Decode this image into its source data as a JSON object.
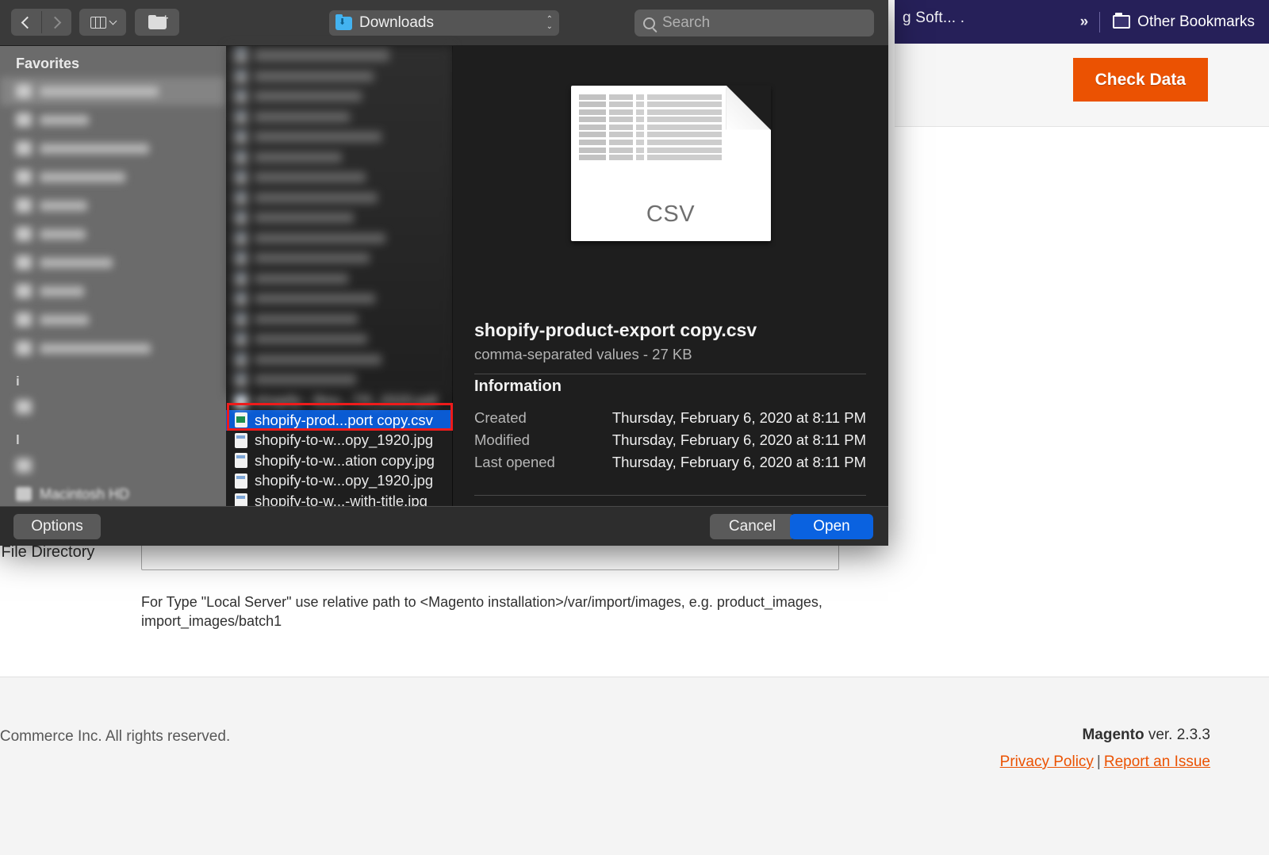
{
  "browser": {
    "bookmarks_truncated_label": "g Soft... .",
    "overflow_chevrons": "»",
    "other_bookmarks_label": "Other Bookmarks"
  },
  "page": {
    "check_data_button": "Check Data",
    "field_label": "s File Directory",
    "field_value": "",
    "field_placeholder": "",
    "hint": "For Type \"Local Server\" use relative path to <Magento installation>/var/import/images, e.g. product_images, import_images/batch1",
    "footer": {
      "copyright": "o Commerce Inc. All rights reserved.",
      "brand": "Magento",
      "version": "ver. 2.3.3",
      "privacy_policy": "Privacy Policy",
      "separator": "|",
      "report_issue": "Report an Issue"
    },
    "accent_orange": "#eb5202",
    "bookmarkbar_color": "#262059"
  },
  "finder": {
    "toolbar": {
      "back_icon": "chevron-left-icon",
      "forward_icon": "chevron-right-icon",
      "view_icon": "column-view-icon",
      "view_chevron": "chevron-down-icon",
      "new_folder_icon": "new-folder-icon",
      "path_label": "Downloads",
      "path_icon": "downloads-folder-icon",
      "stepper_up": "⌃",
      "stepper_down": "⌄",
      "search_placeholder": "Search",
      "search_icon": "search-icon",
      "search_value": ""
    },
    "sidebar": {
      "header": "Favorites",
      "items": [
        {
          "label": "",
          "selected": true,
          "blurred": true
        },
        {
          "label": "",
          "selected": false,
          "blurred": true
        },
        {
          "label": "",
          "selected": false,
          "blurred": true
        },
        {
          "label": "",
          "selected": false,
          "blurred": true
        },
        {
          "label": "",
          "selected": false,
          "blurred": true
        },
        {
          "label": "",
          "selected": false,
          "blurred": true
        },
        {
          "label": "",
          "selected": false,
          "blurred": true
        },
        {
          "label": "",
          "selected": false,
          "blurred": true
        },
        {
          "label": "",
          "selected": false,
          "blurred": true
        },
        {
          "label": "",
          "selected": false,
          "blurred": true
        }
      ],
      "group_icloud": "i",
      "icloud_items": [
        {
          "label": "",
          "blurred": true
        }
      ],
      "group_locations": "l",
      "locations_items": [
        {
          "label": "",
          "blurred": true
        }
      ],
      "macintosh_hd": "Macintosh HD"
    },
    "file_list": {
      "blurred_rows": 17,
      "visible_rows": [
        {
          "name": "shopify - Bou...TR_2020.pdf",
          "blurred": true,
          "selected": false,
          "type": "pdf"
        },
        {
          "name": "shopify-prod...port copy.csv",
          "blurred": false,
          "selected": true,
          "type": "csv"
        },
        {
          "name": "shopify-to-w...opy_1920.jpg",
          "blurred": false,
          "selected": false,
          "type": "jpg"
        },
        {
          "name": "shopify-to-w...ation copy.jpg",
          "blurred": false,
          "selected": false,
          "type": "jpg"
        },
        {
          "name": "shopify-to-w...opy_1920.jpg",
          "blurred": false,
          "selected": false,
          "type": "jpg"
        },
        {
          "name": "shopify-to-w...-with-title.jpg",
          "blurred": false,
          "selected": false,
          "type": "jpg"
        }
      ],
      "selection_outline_color": "#ee1b1b",
      "selection_color": "#0a5bd3"
    },
    "preview": {
      "doc_kind_label": "CSV",
      "file_name": "shopify-product-export copy.csv",
      "file_meta": "comma-separated values - 27 KB",
      "section_title": "Information",
      "rows": [
        {
          "key": "Created",
          "value": "Thursday, February 6, 2020 at 8:11 PM"
        },
        {
          "key": "Modified",
          "value": "Thursday, February 6, 2020 at 8:11 PM"
        },
        {
          "key": "Last opened",
          "value": "Thursday, February 6, 2020 at 8:11 PM"
        }
      ]
    },
    "buttons": {
      "options": "Options",
      "cancel": "Cancel",
      "open": "Open"
    }
  }
}
